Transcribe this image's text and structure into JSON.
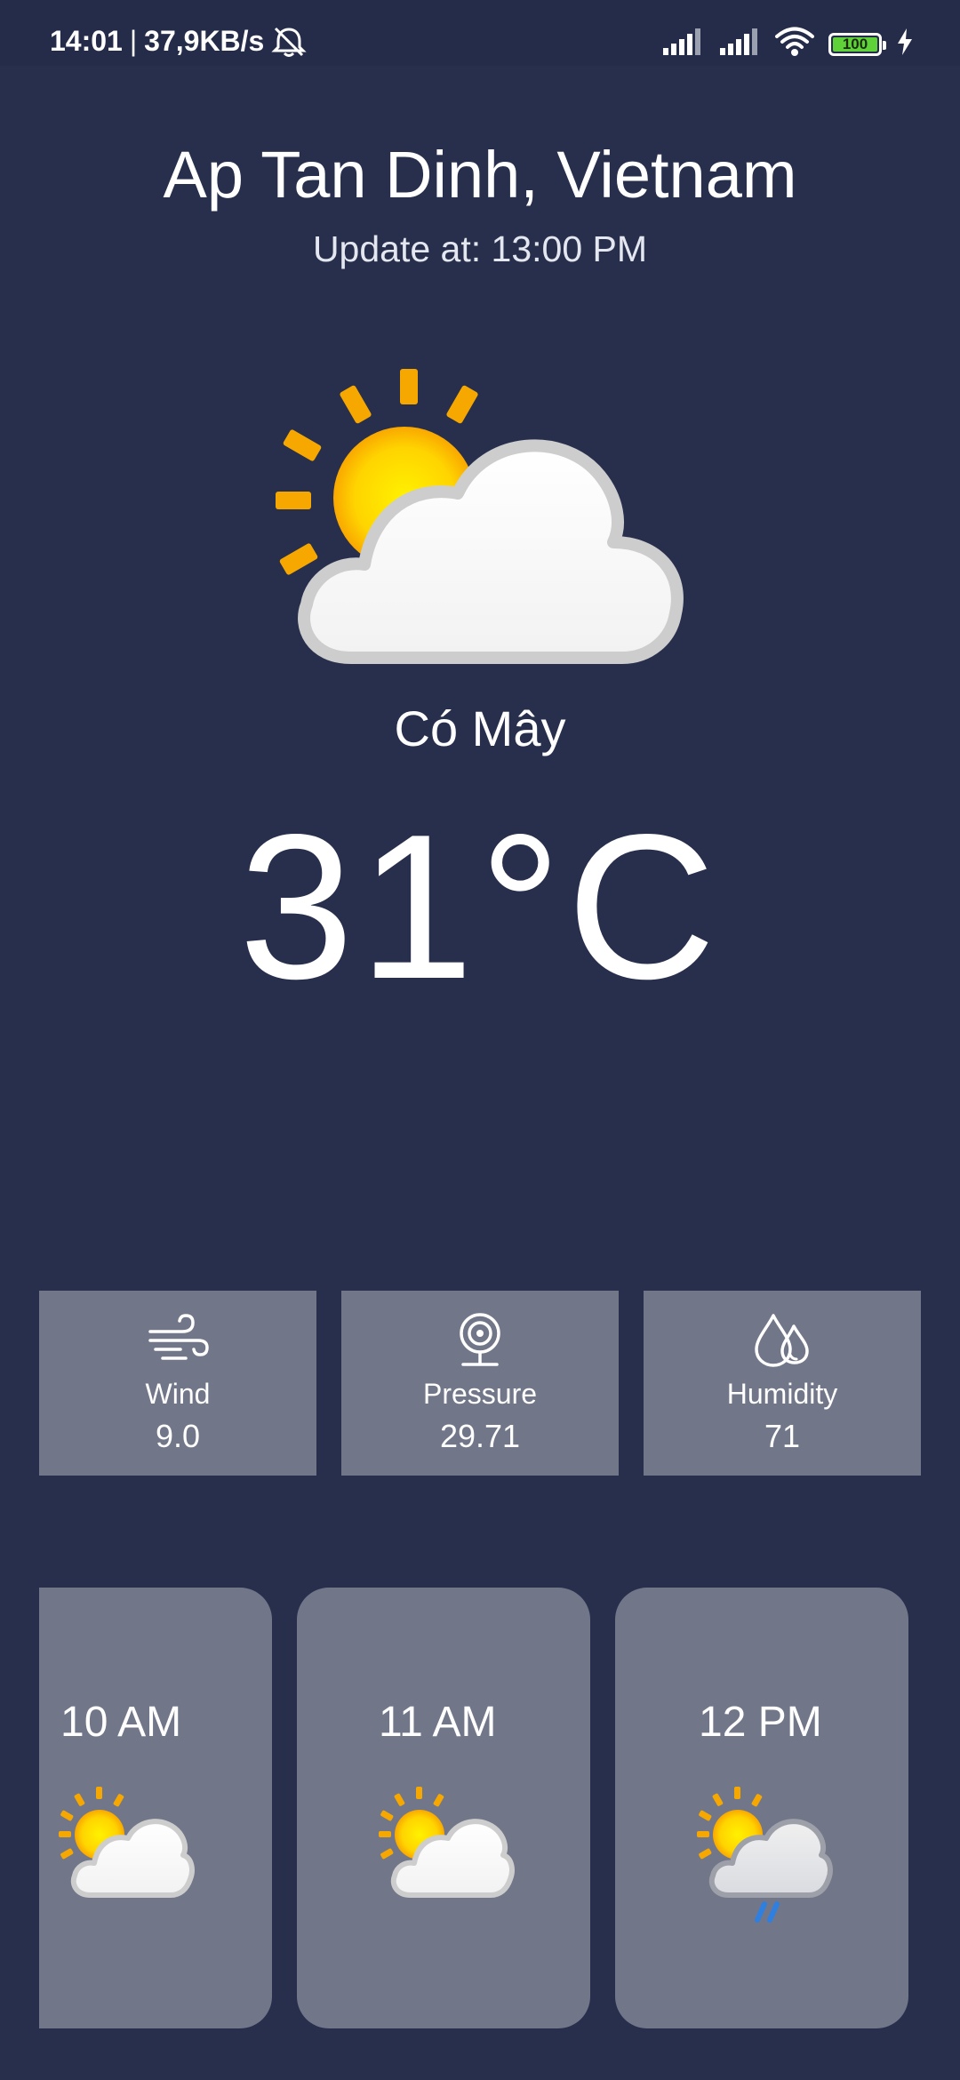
{
  "status_bar": {
    "time": "14:01",
    "separator": "|",
    "network_speed": "37,9KB/s",
    "icons": [
      "alarm-off-icon",
      "signal-icon",
      "signal-icon",
      "wifi-icon",
      "battery-icon",
      "charging-icon"
    ],
    "battery_level": "100",
    "battery_fraction": 1.0
  },
  "header": {
    "location": "Ap Tan Dinh, Vietnam",
    "updated": "Update at: 13:00 PM"
  },
  "current": {
    "icon": "partly-cloudy-icon",
    "condition": "Có Mây",
    "temperature": "31°C"
  },
  "stats": [
    {
      "icon": "wind-icon",
      "label": "Wind",
      "value": "9.0"
    },
    {
      "icon": "pressure-icon",
      "label": "Pressure",
      "value": "29.71"
    },
    {
      "icon": "humidity-icon",
      "label": "Humidity",
      "value": "71"
    }
  ],
  "hourly": [
    {
      "time": "10 AM",
      "icon": "partly-cloudy-icon"
    },
    {
      "time": "11 AM",
      "icon": "partly-cloudy-icon"
    },
    {
      "time": "12 PM",
      "icon": "partly-cloudy-rain-icon"
    }
  ],
  "colors": {
    "background": "#272f4d",
    "card": "#717789",
    "sun": "#fdd000",
    "sun_rays": "#f7a800",
    "cloud": "#ffffff",
    "rain": "#2f7fe0"
  }
}
